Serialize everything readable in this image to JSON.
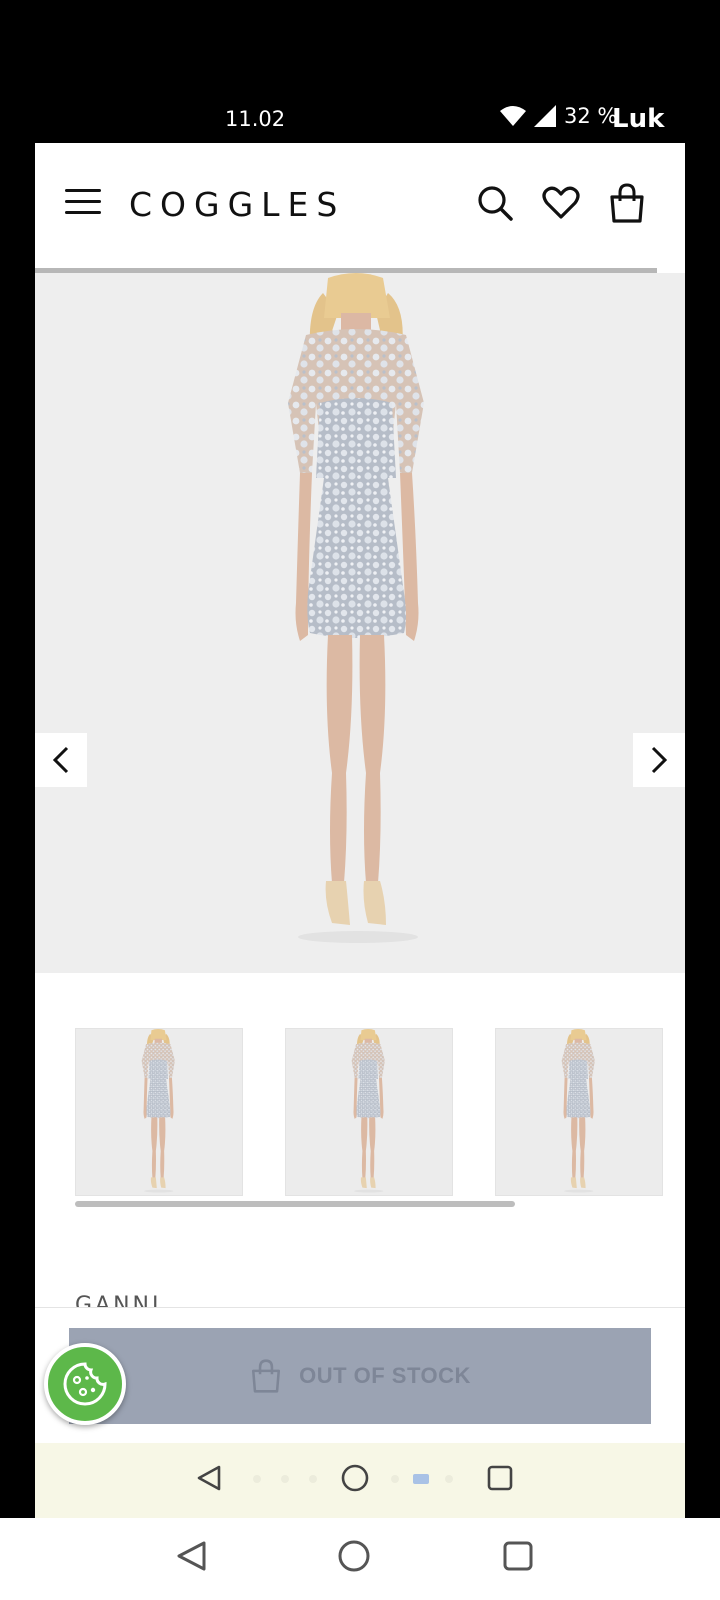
{
  "status_bar": {
    "time": "11.02",
    "battery": "32 %",
    "overlay_label": "Luk"
  },
  "header": {
    "logo": "COGGLES",
    "icons": [
      "hamburger-menu-icon",
      "search-icon",
      "heart-icon",
      "shopping-bag-icon"
    ]
  },
  "gallery": {
    "product_image": "grey-lace-dress-back-view",
    "prev_icon": "chevron-left-icon",
    "next_icon": "chevron-right-icon",
    "zoom_icon": "zoom-in-icon"
  },
  "thumbnails": [
    {
      "view": "front"
    },
    {
      "view": "side"
    },
    {
      "view": "back"
    }
  ],
  "product": {
    "brand": "GANNI"
  },
  "cta": {
    "label": "OUT OF STOCK",
    "icon": "shopping-bag-icon",
    "color": "#9ba3b3"
  },
  "cookie": {
    "icon": "cookie-icon",
    "color": "#5db84a"
  }
}
